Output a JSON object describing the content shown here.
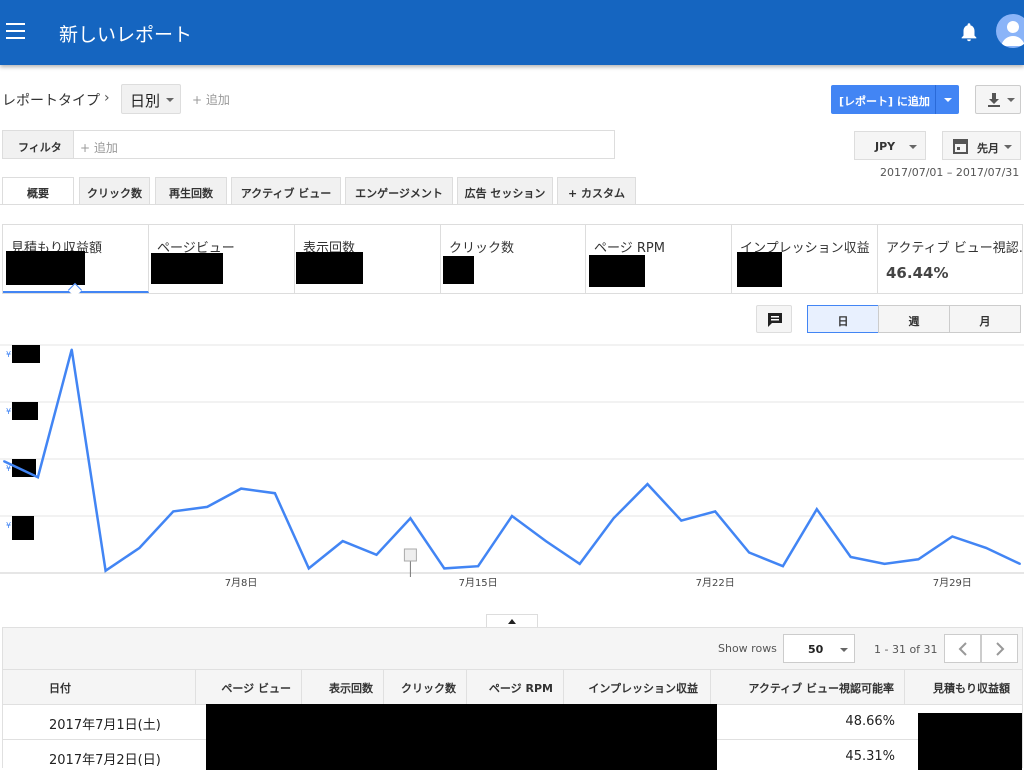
{
  "header": {
    "title": "新しいレポート"
  },
  "report_bar": {
    "report_type_label": "レポートタイプ",
    "granularity_selected": "日別",
    "add_label": "+ 追加",
    "add_to_report_button": "[レポート] に追加"
  },
  "filter_bar": {
    "filter_label": "フィルタ",
    "filter_placeholder": "+ 追加",
    "currency": "JPY",
    "period": "先月",
    "date_range": "2017/07/01 – 2017/07/31"
  },
  "tabs": [
    {
      "label": "概要",
      "active": true
    },
    {
      "label": "クリック数"
    },
    {
      "label": "再生回数"
    },
    {
      "label": "アクティブ ビュー"
    },
    {
      "label": "エンゲージメント"
    },
    {
      "label": "広告 セッション"
    },
    {
      "label": "+ カスタム"
    }
  ],
  "metrics": [
    {
      "label": "見積もり収益額",
      "value_hidden": true,
      "active": true
    },
    {
      "label": "ページビュー",
      "value_hidden": true
    },
    {
      "label": "表示回数",
      "value_hidden": true
    },
    {
      "label": "クリック数",
      "value_hidden": true
    },
    {
      "label": "ページ RPM",
      "value_hidden": true
    },
    {
      "label": "インプレッション収益",
      "value_hidden": true
    },
    {
      "label": "アクティブ ビュー視認...",
      "value": "46.44%"
    }
  ],
  "chart_controls": {
    "granularity": [
      "日",
      "週",
      "月"
    ],
    "selected": "日"
  },
  "chart_data": {
    "type": "line",
    "x_tick_labels": [
      "7月8日",
      "7月15日",
      "7月22日",
      "7月29日"
    ],
    "y_tick_prefix": "¥",
    "y_values_redacted": true,
    "series": [
      {
        "color": "#4285f4",
        "values": [
          0.49,
          0.42,
          0.98,
          0.01,
          0.11,
          0.27,
          0.29,
          0.37,
          0.35,
          0.02,
          0.14,
          0.08,
          0.24,
          0.02,
          0.03,
          0.25,
          0.14,
          0.04,
          0.24,
          0.39,
          0.23,
          0.27,
          0.09,
          0.03,
          0.28,
          0.07,
          0.04,
          0.06,
          0.16,
          0.11,
          0.04
        ]
      }
    ],
    "annotation_day": 12,
    "grid": true
  },
  "table": {
    "show_rows_label": "Show rows",
    "rows_per_page": "50",
    "page_info": "1 - 31 of 31",
    "columns": [
      "日付",
      "ページ ビュー",
      "表示回数",
      "クリック数",
      "ページ RPM",
      "インプレッション収益",
      "アクティブ ビュー視認可能率",
      "見積もり収益額"
    ],
    "rows": [
      {
        "date": "2017年7月1日(土)",
        "active_view": "48.66%"
      },
      {
        "date": "2017年7月2日(日)",
        "active_view": "45.31%"
      }
    ]
  }
}
